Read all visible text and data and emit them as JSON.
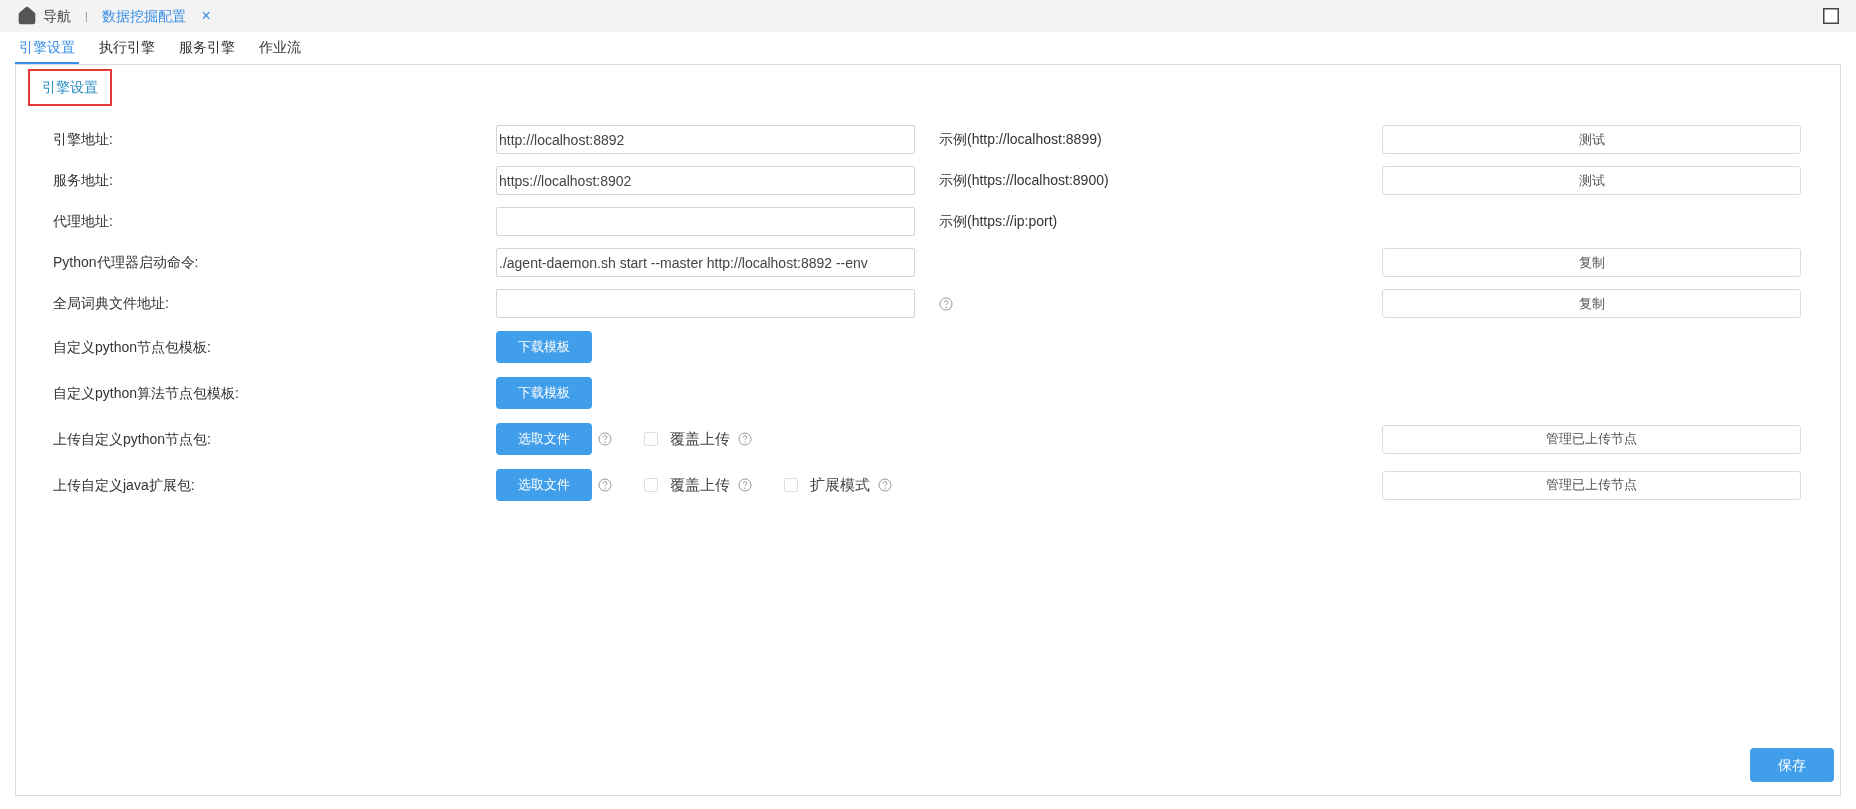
{
  "breadcrumb": {
    "home": "导航",
    "separator": "|",
    "tab": {
      "label": "数据挖掘配置",
      "close": "×"
    }
  },
  "tabs": [
    {
      "label": "引擎设置",
      "selected": true
    },
    {
      "label": "执行引擎",
      "selected": false
    },
    {
      "label": "服务引擎",
      "selected": false
    },
    {
      "label": "作业流",
      "selected": false
    }
  ],
  "section_title": "引擎设置",
  "rows": [
    {
      "kind": "field",
      "label": "引擎地址:",
      "value": "http://localhost:8892",
      "hint": "示例(http://localhost:8899)",
      "action": "测试"
    },
    {
      "kind": "field",
      "label": "服务地址:",
      "value": "https://localhost:8902",
      "hint": "示例(https://localhost:8900)",
      "action": "测试"
    },
    {
      "kind": "field",
      "label": "代理地址:",
      "value": "",
      "hint": "示例(https://ip:port)"
    },
    {
      "kind": "field",
      "label": "Python代理器启动命令:",
      "value": "./agent-daemon.sh start --master http://localhost:8892 --env",
      "action": "复制"
    },
    {
      "kind": "field",
      "label": "全局词典文件地址:",
      "value": "",
      "help": true,
      "action": "复制"
    },
    {
      "kind": "button",
      "label": "自定义python节点包模板:",
      "button": "下载模板"
    },
    {
      "kind": "button",
      "label": "自定义python算法节点包模板:",
      "button": "下载模板"
    },
    {
      "kind": "upload",
      "label": "上传自定义python节点包:",
      "button": "选取文件",
      "options": [
        {
          "label": "覆盖上传",
          "checked": false
        }
      ],
      "action": "管理已上传节点"
    },
    {
      "kind": "upload",
      "label": "上传自定义java扩展包:",
      "button": "选取文件",
      "options": [
        {
          "label": "覆盖上传",
          "checked": false
        },
        {
          "label": "扩展模式",
          "checked": false
        }
      ],
      "action": "管理已上传节点"
    }
  ],
  "save": "保存"
}
